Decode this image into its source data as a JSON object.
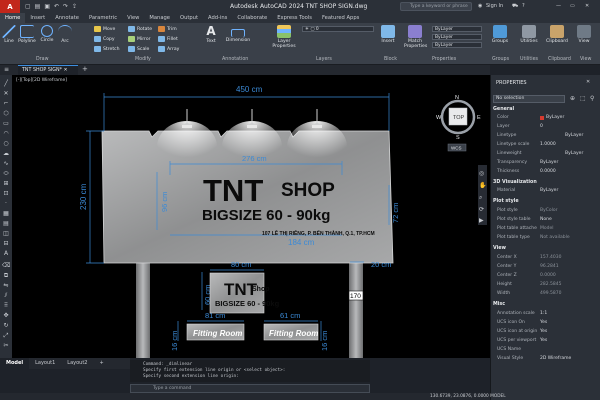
{
  "titlebar": {
    "app_logo": "A",
    "title": "Autodesk AutoCAD 2024   TNT SHOP SIGN.dwg",
    "search_placeholder": "Type a keyword or phrase",
    "signin": "Sign In"
  },
  "ribbon_tabs": [
    "Home",
    "Insert",
    "Annotate",
    "Parametric",
    "View",
    "Manage",
    "Output",
    "Add-ins",
    "Collaborate",
    "Express Tools",
    "Featured Apps"
  ],
  "ribbon": {
    "draw": {
      "title": "Draw",
      "buttons": [
        "Line",
        "Polyline",
        "Circle",
        "Arc"
      ]
    },
    "modify": {
      "title": "Modify",
      "buttons": [
        "Move",
        "Rotate",
        "Trim",
        "Copy",
        "Mirror",
        "Fillet",
        "Stretch",
        "Scale",
        "Array"
      ]
    },
    "annotation": {
      "title": "Annotation",
      "buttons": [
        "Text",
        "Dimension"
      ]
    },
    "layers": {
      "title": "Layers",
      "buttons": [
        "Layer Properties"
      ]
    },
    "block": {
      "title": "Block",
      "buttons": [
        "Insert"
      ]
    },
    "properties": {
      "title": "Properties",
      "bylayer": [
        "ByLayer",
        "ByLayer",
        "ByLayer"
      ],
      "buttons": [
        "Match Properties"
      ]
    },
    "groups": {
      "title": "Groups",
      "label": "Groups"
    },
    "utilities": {
      "title": "Utilities",
      "label": "Utilities"
    },
    "clipboard": {
      "title": "Clipboard",
      "label": "Clipboard"
    },
    "view": {
      "title": "View",
      "label": "View"
    }
  },
  "doc_tab": "TNT SHOP SIGN*",
  "view_label": "[-][Top][2D Wireframe]",
  "viewcube": {
    "top": "TOP",
    "n": "N",
    "s": "S",
    "e": "E",
    "w": "W",
    "wcs": "WCS"
  },
  "drawing": {
    "dim_top": "450 cm",
    "dim_inner_top": "276 cm",
    "dim_left": "230 cm",
    "dim_inner_left": "96 cm",
    "dim_right": "72 cm",
    "dim_inner_bottom": "184 cm",
    "dim_post": "20 cm",
    "dim_small_w": "80 cm",
    "dim_small_h": "60 cm",
    "dim_fit_left_w": "81 cm",
    "dim_fit_right_w": "61 cm",
    "dim_fit_left_h": "16 cm",
    "dim_fit_right_h": "16 cm",
    "dim_input": "170",
    "sign_title": "TNT",
    "sign_shop": "SHOP",
    "sign_sub": "BIGSIZE 60 - 90kg",
    "sign_addr": "107 LÊ THỊ RIÊNG, P. BẾN THÀNH, Q.1, TP.HCM",
    "small_title": "TNT",
    "small_shop": "Shop",
    "small_sub": "BIGSIZE 60 - 90kg",
    "fitting_left": "Fitting Room",
    "fitting_right": "Fitting Room"
  },
  "properties": {
    "title": "PROPERTIES",
    "selection": "No selection",
    "sections": [
      {
        "name": "General",
        "rows": [
          [
            "Color",
            "ByLayer"
          ],
          [
            "Layer",
            "0"
          ],
          [
            "Linetype",
            "ByLayer"
          ],
          [
            "Linetype scale",
            "1.0000"
          ],
          [
            "Lineweight",
            "ByLayer"
          ],
          [
            "Transparency",
            "ByLayer"
          ],
          [
            "Thickness",
            "0.0000"
          ]
        ]
      },
      {
        "name": "3D Visualization",
        "rows": [
          [
            "Material",
            "ByLayer"
          ]
        ]
      },
      {
        "name": "Plot style",
        "rows": [
          [
            "Plot style",
            "ByColor"
          ],
          [
            "Plot style table",
            "None"
          ],
          [
            "Plot table attache",
            "Model"
          ],
          [
            "Plot table type",
            "Not available"
          ]
        ]
      },
      {
        "name": "View",
        "rows": [
          [
            "Center X",
            "157.4030"
          ],
          [
            "Center Y",
            "96.2841"
          ],
          [
            "Center Z",
            "0.0000"
          ],
          [
            "Height",
            "282.5845"
          ],
          [
            "Width",
            "499.5870"
          ]
        ]
      },
      {
        "name": "Misc",
        "rows": [
          [
            "Annotation scale",
            "1:1"
          ],
          [
            "UCS icon On",
            "Yes"
          ],
          [
            "UCS icon at origin",
            "Yes"
          ],
          [
            "UCS per viewport",
            "Yes"
          ],
          [
            "UCS Name",
            ""
          ],
          [
            "Visual Style",
            "2D Wireframe"
          ]
        ]
      }
    ]
  },
  "layout_tabs": [
    "Model",
    "Layout1",
    "Layout2"
  ],
  "command": {
    "history": [
      "Command: _dimlinear",
      "Specify first extension line origin or <select object>:",
      "Specify second extension line origin:"
    ],
    "placeholder": "Type a command"
  },
  "status": {
    "coords": "130.6739, 23.0876, 0.0000",
    "mode": "MODEL"
  },
  "colors": {
    "accent": "#3c8ee0",
    "dim": "#3b8ad6",
    "app_red": "#c2271b"
  }
}
